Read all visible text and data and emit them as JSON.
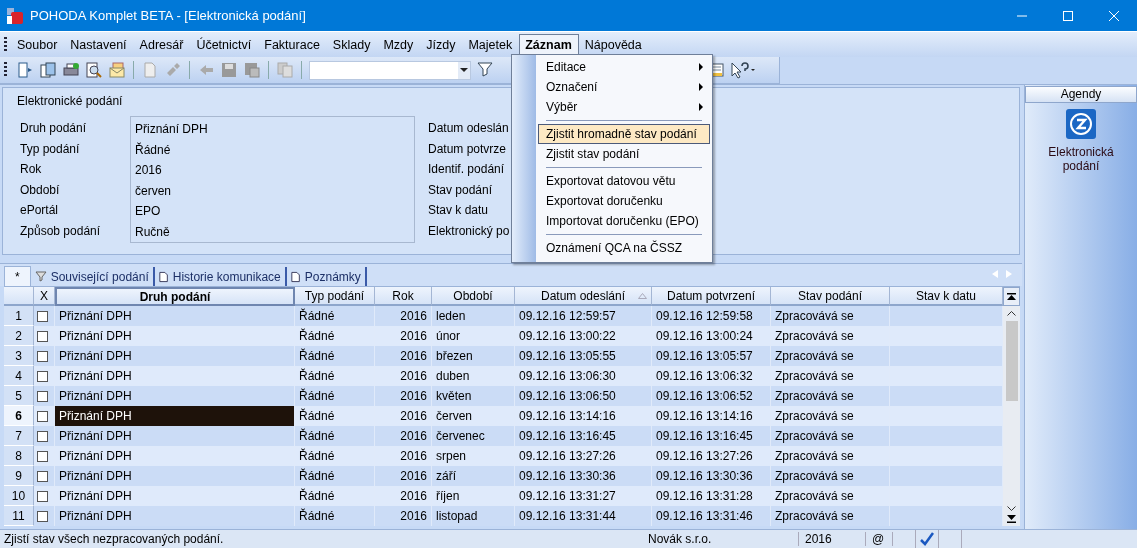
{
  "window": {
    "title": "POHODA Komplet BETA - [Elektronická podání]"
  },
  "menu": [
    {
      "label": "Soubor",
      "open": false
    },
    {
      "label": "Nastavení",
      "open": false
    },
    {
      "label": "Adresář",
      "open": false
    },
    {
      "label": "Účetnictví",
      "open": false
    },
    {
      "label": "Fakturace",
      "open": false
    },
    {
      "label": "Sklady",
      "open": false
    },
    {
      "label": "Mzdy",
      "open": false
    },
    {
      "label": "Jízdy",
      "open": false
    },
    {
      "label": "Majetek",
      "open": false
    },
    {
      "label": "Záznam",
      "open": true
    },
    {
      "label": "Nápověda",
      "open": false
    }
  ],
  "dropdown": {
    "groups": [
      [
        {
          "label": "Editace",
          "submenu": true,
          "selected": false
        },
        {
          "label": "Označení",
          "submenu": true,
          "selected": false
        },
        {
          "label": "Výběr",
          "submenu": true,
          "selected": false
        }
      ],
      [
        {
          "label": "Zjistit hromadně stav podání",
          "submenu": false,
          "selected": true
        },
        {
          "label": "Zjistit stav podání",
          "submenu": false,
          "selected": false
        }
      ],
      [
        {
          "label": "Exportovat datovou větu",
          "submenu": false,
          "selected": false
        },
        {
          "label": "Exportovat doručenku",
          "submenu": false,
          "selected": false
        },
        {
          "label": "Importovat doručenku (EPO)",
          "submenu": false,
          "selected": false
        }
      ],
      [
        {
          "label": "Oznámení QCA na ČSSZ",
          "submenu": false,
          "selected": false
        }
      ]
    ]
  },
  "form": {
    "title": "Elektronické podání",
    "fields": [
      {
        "label": "Druh podání",
        "value": "Přiznání DPH"
      },
      {
        "label": "Typ podání",
        "value": "Řádné"
      },
      {
        "label": "Rok",
        "value": "2016"
      },
      {
        "label": "Období",
        "value": "červen"
      },
      {
        "label": "ePortál",
        "value": "EPO"
      },
      {
        "label": "Způsob podání",
        "value": "Ručně"
      }
    ],
    "right_labels": [
      "Datum odeslán",
      "Datum potvrze",
      "Identif. podání",
      "Stav podání",
      "Stav k datu",
      "Elektronický po"
    ]
  },
  "tabs": [
    {
      "label": "*",
      "kind": "plain",
      "selected": true
    },
    {
      "label": "Související podání",
      "kind": "filter",
      "selected": false
    },
    {
      "label": "Historie komunikace",
      "kind": "page",
      "selected": false
    },
    {
      "label": "Poznámky",
      "kind": "page",
      "selected": false
    }
  ],
  "table": {
    "checkbox_column": "X",
    "columns": [
      {
        "label": "Druh podání",
        "selected": true,
        "sorted": false
      },
      {
        "label": "Typ podání",
        "selected": false,
        "sorted": false
      },
      {
        "label": "Rok",
        "selected": false,
        "sorted": false
      },
      {
        "label": "Období",
        "selected": false,
        "sorted": false
      },
      {
        "label": "Datum odeslání",
        "selected": false,
        "sorted": true
      },
      {
        "label": "Datum potvrzení",
        "selected": false,
        "sorted": false
      },
      {
        "label": "Stav podání",
        "selected": false,
        "sorted": false
      },
      {
        "label": "Stav k datu",
        "selected": false,
        "sorted": false
      }
    ],
    "rows": [
      {
        "number": "1",
        "checked": false,
        "selected": false,
        "cells": [
          "Přiznání DPH",
          "Řádné",
          "2016",
          "leden",
          "09.12.16 12:59:57",
          "09.12.16 12:59:58",
          "Zpracovává se"
        ]
      },
      {
        "number": "2",
        "checked": false,
        "selected": false,
        "cells": [
          "Přiznání DPH",
          "Řádné",
          "2016",
          "únor",
          "09.12.16 13:00:22",
          "09.12.16 13:00:24",
          "Zpracovává se"
        ]
      },
      {
        "number": "3",
        "checked": false,
        "selected": false,
        "cells": [
          "Přiznání DPH",
          "Řádné",
          "2016",
          "březen",
          "09.12.16 13:05:55",
          "09.12.16 13:05:57",
          "Zpracovává se"
        ]
      },
      {
        "number": "4",
        "checked": false,
        "selected": false,
        "cells": [
          "Přiznání DPH",
          "Řádné",
          "2016",
          "duben",
          "09.12.16 13:06:30",
          "09.12.16 13:06:32",
          "Zpracovává se"
        ]
      },
      {
        "number": "5",
        "checked": false,
        "selected": false,
        "cells": [
          "Přiznání DPH",
          "Řádné",
          "2016",
          "květen",
          "09.12.16 13:06:50",
          "09.12.16 13:06:52",
          "Zpracovává se"
        ]
      },
      {
        "number": "6",
        "checked": false,
        "selected": true,
        "cells": [
          "Přiznání DPH",
          "Řádné",
          "2016",
          "červen",
          "09.12.16 13:14:16",
          "09.12.16 13:14:16",
          "Zpracovává se"
        ]
      },
      {
        "number": "7",
        "checked": false,
        "selected": false,
        "cells": [
          "Přiznání DPH",
          "Řádné",
          "2016",
          "červenec",
          "09.12.16 13:16:45",
          "09.12.16 13:16:45",
          "Zpracovává se"
        ]
      },
      {
        "number": "8",
        "checked": false,
        "selected": false,
        "cells": [
          "Přiznání DPH",
          "Řádné",
          "2016",
          "srpen",
          "09.12.16 13:27:26",
          "09.12.16 13:27:26",
          "Zpracovává se"
        ]
      },
      {
        "number": "9",
        "checked": false,
        "selected": false,
        "cells": [
          "Přiznání DPH",
          "Řádné",
          "2016",
          "září",
          "09.12.16 13:30:36",
          "09.12.16 13:30:36",
          "Zpracovává se"
        ]
      },
      {
        "number": "10",
        "checked": false,
        "selected": false,
        "cells": [
          "Přiznání DPH",
          "Řádné",
          "2016",
          "říjen",
          "09.12.16 13:31:27",
          "09.12.16 13:31:28",
          "Zpracovává se"
        ]
      },
      {
        "number": "11",
        "checked": false,
        "selected": false,
        "cells": [
          "Přiznání DPH",
          "Řádné",
          "2016",
          "listopad",
          "09.12.16 13:31:44",
          "09.12.16 13:31:46",
          "Zpracovává se"
        ]
      }
    ]
  },
  "agendy": {
    "title": "Agendy",
    "items": [
      {
        "label": "Elektronická podání"
      }
    ]
  },
  "status_bar": {
    "message": "Zjistí stav všech nezpracovaných podání.",
    "company": "Novák s.r.o.",
    "year": "2016",
    "at": "@"
  }
}
